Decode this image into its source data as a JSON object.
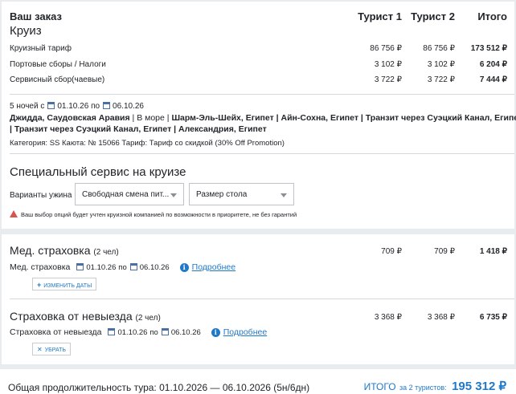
{
  "order": {
    "title": "Ваш заказ",
    "cruise_label": "Круиз",
    "col_tourist1": "Турист 1",
    "col_tourist2": "Турист 2",
    "col_total": "Итого",
    "rows": [
      {
        "label": "Круизный тариф",
        "t1": "86 756 ₽",
        "t2": "86 756 ₽",
        "total": "173 512 ₽"
      },
      {
        "label": "Портовые сборы / Налоги",
        "t1": "3 102 ₽",
        "t2": "3 102 ₽",
        "total": "6 204 ₽"
      },
      {
        "label": "Сервисный сбор(чаевые)",
        "t1": "3 722 ₽",
        "t2": "3 722 ₽",
        "total": "7 444 ₽"
      }
    ]
  },
  "itinerary": {
    "nights": "5 ночей с",
    "date_from": "01.10.26",
    "to_word": "по",
    "date_to": "06.10.26",
    "route_line1_a": "Джидда, Саудовская Аравия",
    "route_line1_b": " | В море | ",
    "route_line1_c": "Шарм-Эль-Шейх, Египет | Айн-Сохна, Египет | Транзит через Суэцкий Канал, Египет",
    "route_line2": "| Транзит через Суэцкий Канал, Египет | Александрия, Египет",
    "category": "Категория: SS  Каюта: № 15066  Тариф: Тариф со скидкой (30% Off Promotion)"
  },
  "special": {
    "title": "Специальный сервис на круизе",
    "dinner_label": "Варианты ужина",
    "dinner_value": "Свободная смена пит...",
    "table_value": "Размер стола",
    "warning": "Ваш выбор опций будет учтен круизной компанией по возможности в приоритете, не без гарантий"
  },
  "insurance": {
    "title": "Мед. страховка",
    "persons": "(2 чел)",
    "t1": "709 ₽",
    "t2": "709 ₽",
    "total": "1 418 ₽",
    "line_label": "Мед. страховка",
    "date_from": "01.10.26",
    "to_word": "по",
    "date_to": "06.10.26",
    "more": "Подробнее",
    "button": "ИЗМЕНИТЬ ДАТЫ"
  },
  "cancel_insurance": {
    "title": "Страховка от невыезда",
    "persons": "(2 чел)",
    "t1": "3 368 ₽",
    "t2": "3 368 ₽",
    "total": "6 735 ₽",
    "line_label": "Страховка от невыезда",
    "date_from": "01.10.26",
    "to_word": "по",
    "date_to": "06.10.26",
    "more": "Подробнее",
    "button": "УБРАТЬ"
  },
  "footer": {
    "duration": "Общая продолжительность тура: 01.10.2026 — 06.10.2026 (5н/6дн)",
    "total_label": "ИТОГО",
    "total_for": "за 2 туристов:",
    "total_value": "195 312 ₽"
  },
  "colors": {
    "accent": "#1f78c8",
    "warning": "#d9534f",
    "background": "#e9ecef"
  }
}
